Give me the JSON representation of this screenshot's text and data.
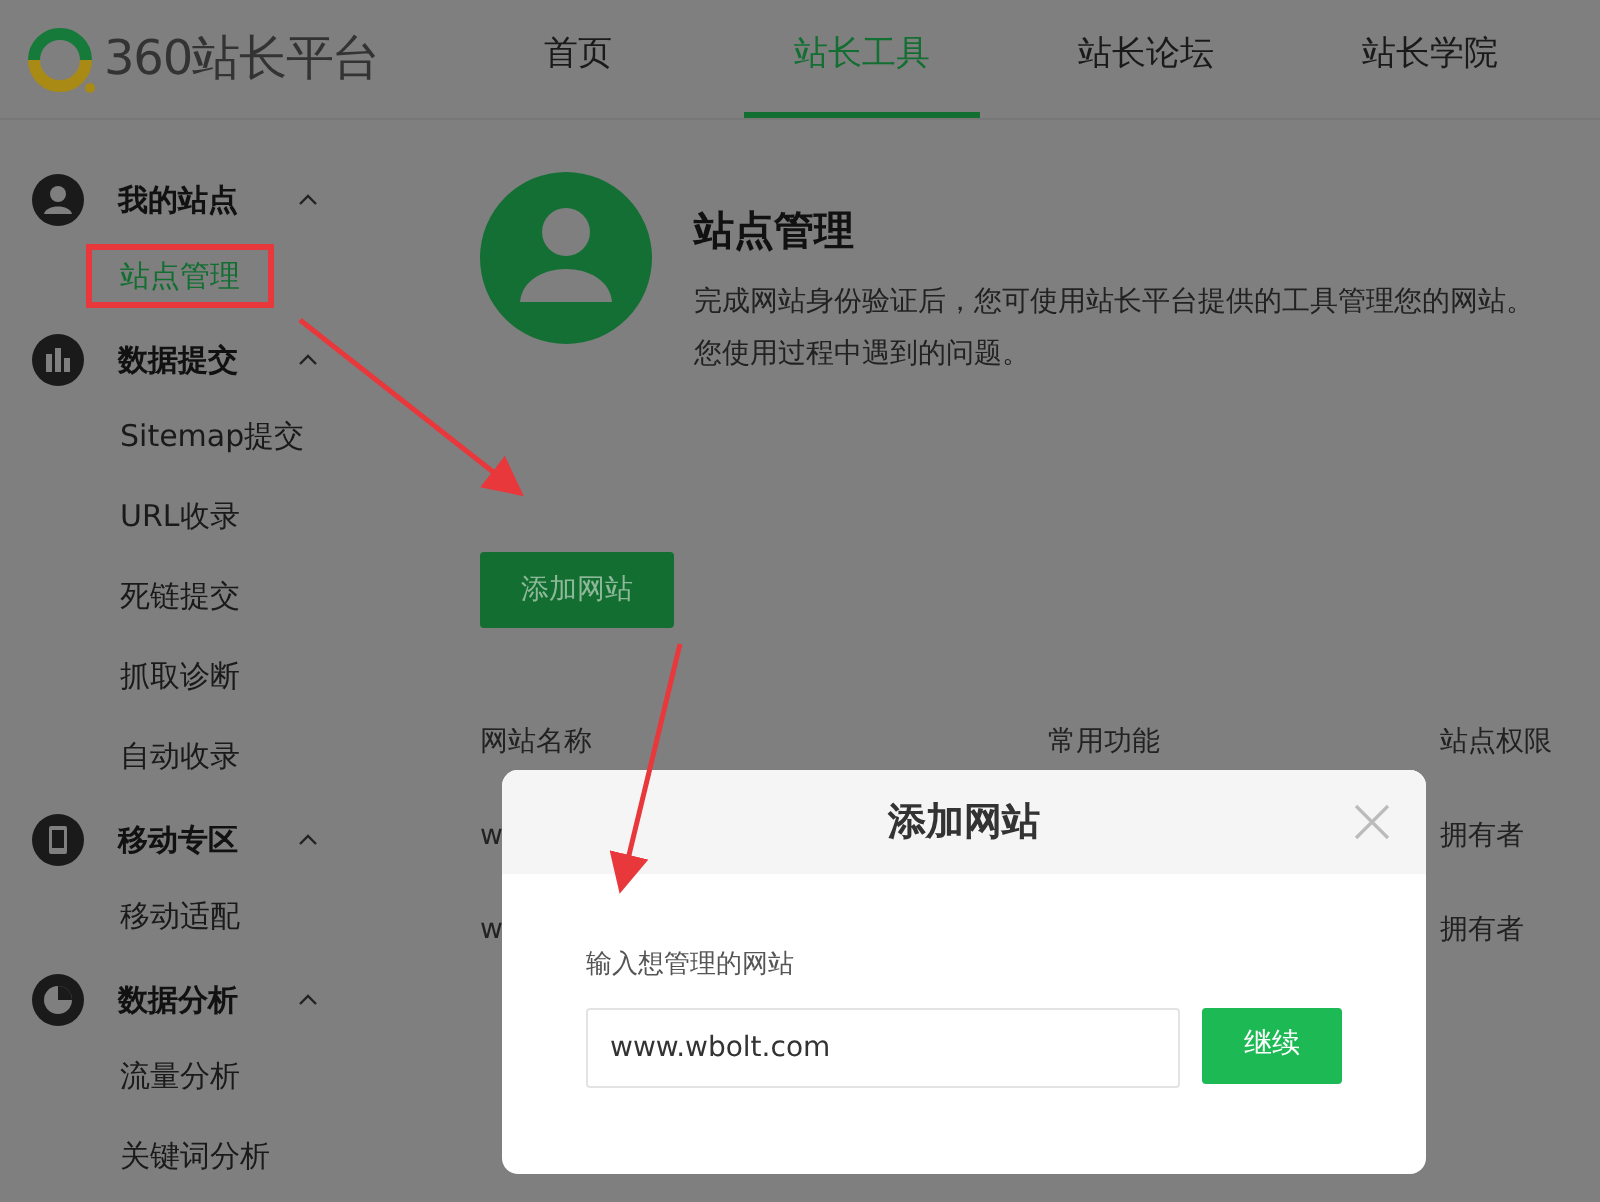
{
  "logo": {
    "text": "360站长平台"
  },
  "nav": [
    {
      "label": "首页",
      "selected": false
    },
    {
      "label": "站长工具",
      "selected": true
    },
    {
      "label": "站长论坛",
      "selected": false
    },
    {
      "label": "站长学院",
      "selected": false
    }
  ],
  "sidebar": [
    {
      "title": "我的站点",
      "expanded": true,
      "children": [
        {
          "label": "站点管理",
          "selected": true,
          "highlighted": true
        }
      ]
    },
    {
      "title": "数据提交",
      "expanded": true,
      "children": [
        {
          "label": "Sitemap提交",
          "selected": false,
          "highlighted": false
        },
        {
          "label": "URL收录",
          "selected": false,
          "highlighted": false
        },
        {
          "label": "死链提交",
          "selected": false,
          "highlighted": false
        },
        {
          "label": "抓取诊断",
          "selected": false,
          "highlighted": false
        },
        {
          "label": "自动收录",
          "selected": false,
          "highlighted": false
        }
      ]
    },
    {
      "title": "移动专区",
      "expanded": true,
      "children": [
        {
          "label": "移动适配",
          "selected": false,
          "highlighted": false
        }
      ]
    },
    {
      "title": "数据分析",
      "expanded": true,
      "children": [
        {
          "label": "流量分析",
          "selected": false,
          "highlighted": false
        },
        {
          "label": "关键词分析",
          "selected": false,
          "highlighted": false
        }
      ]
    }
  ],
  "intro": {
    "title": "站点管理",
    "description_lines": [
      "完成网站身份验证后，您可使用站长平台提供的工具管理您的网站。",
      "您使用过程中遇到的问题。"
    ]
  },
  "add_button": "添加网站",
  "table": {
    "columns": [
      "网站名称",
      "常用功能",
      "站点权限"
    ],
    "rows": [
      {
        "column_1": "w",
        "column_3": "拥有者"
      },
      {
        "column_1": "w",
        "column_3": "拥有者"
      }
    ]
  },
  "dialog": {
    "title": "添加网站",
    "label": "输入想管理的网站",
    "value": "www.wbolt.com",
    "button": "继续"
  }
}
